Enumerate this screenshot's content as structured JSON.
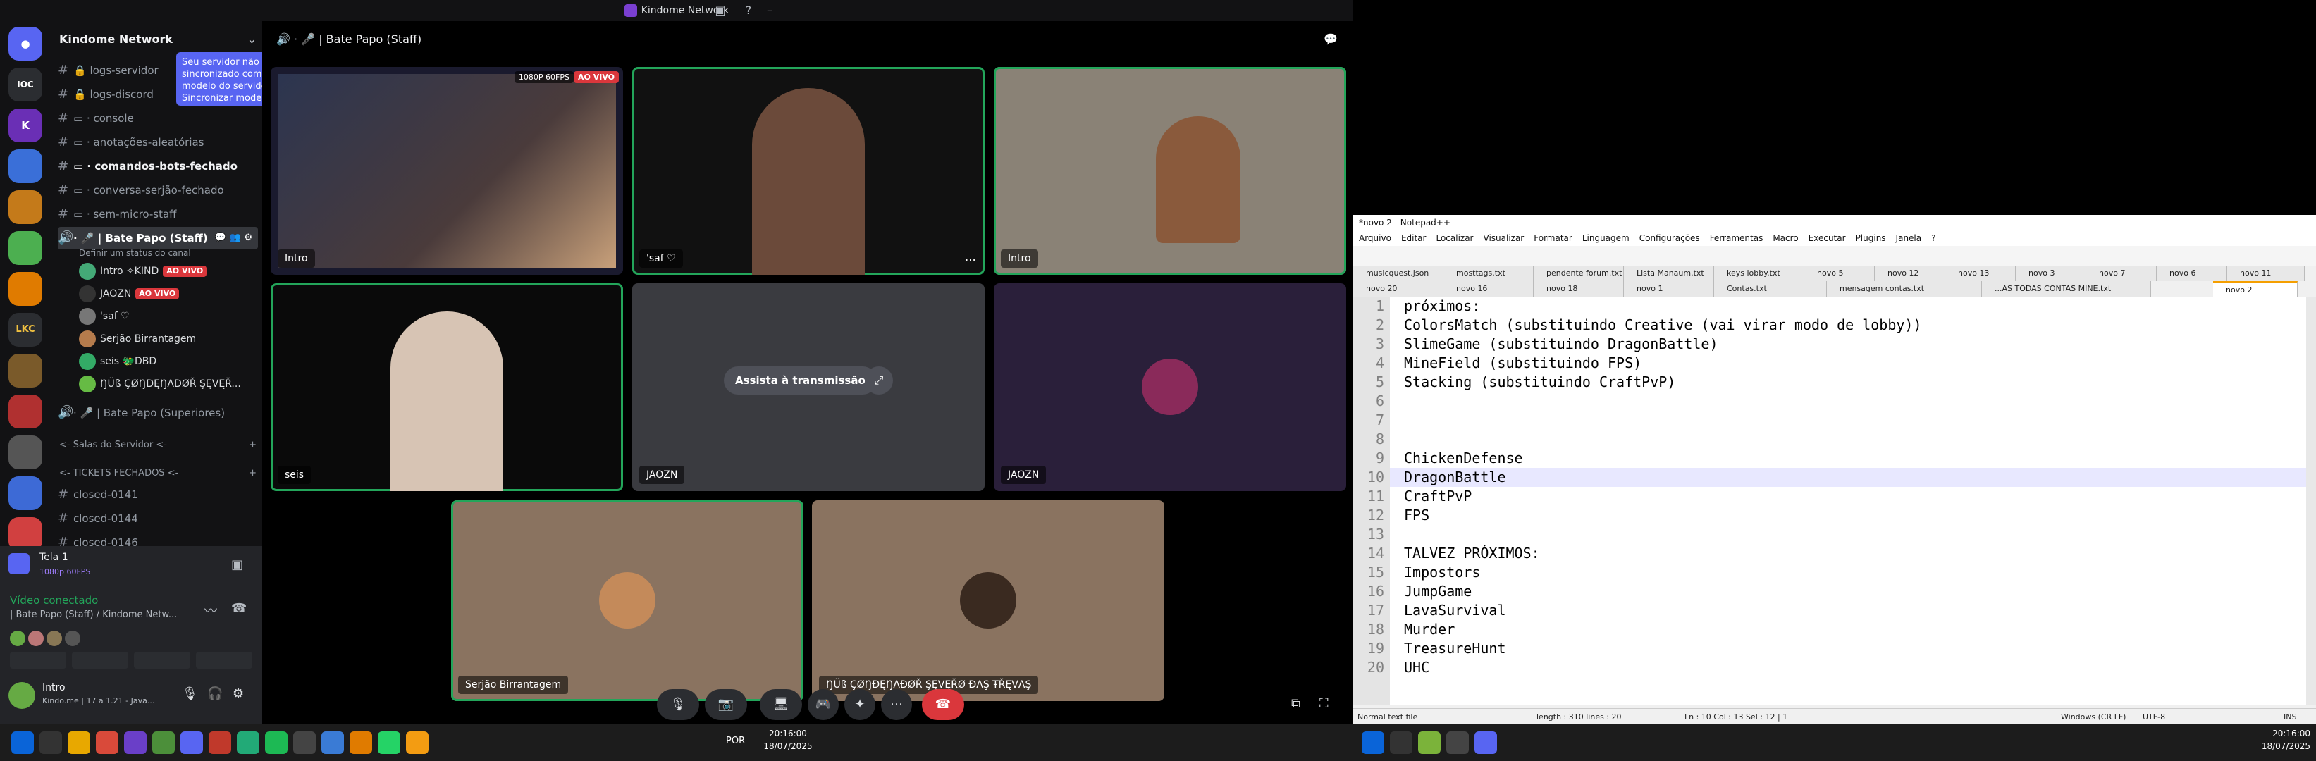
{
  "discord": {
    "window_title": "Kindome Network",
    "server_name": "Kindome Network",
    "tooltip": "Seu servidor não está sincronizado com o modelo do servidor. Sincronizar modelo?",
    "channels": [
      {
        "name": "logs-servidor"
      },
      {
        "name": "logs-discord"
      },
      {
        "name": "console"
      },
      {
        "name": "anotações-aleatórias"
      },
      {
        "name": "comandos-bots-fechado"
      },
      {
        "name": "conversa-serjão-fechado"
      },
      {
        "name": "sem-micro-staff"
      }
    ],
    "active_voice_channel": "| Bate Papo (Staff)",
    "channel_status_hint": "Definir um status do canal",
    "voice_users": [
      {
        "name": "Intro ✧KIND",
        "live": "AO VIVO"
      },
      {
        "name": "JAOZN",
        "live": "AO VIVO"
      },
      {
        "name": "'saf ♡",
        "live": ""
      },
      {
        "name": "Serjão Birrantagem",
        "live": ""
      },
      {
        "name": "seis 🐲DBD",
        "live": ""
      },
      {
        "name": "ŊŨß ÇØŊĐĘŊΛĐØŘ ŞĘVĘŘ...",
        "live": ""
      }
    ],
    "voice_channel_2": "| Bate Papo (Superiores)",
    "categories": [
      "<- Salas do Servidor <-",
      "<- TICKETS FECHADOS <-"
    ],
    "closed_channels": [
      "closed-0141",
      "closed-0144",
      "closed-0146"
    ],
    "stream_panel": {
      "title": "Tela 1",
      "quality": "1080p 60FPS"
    },
    "voice_status": {
      "title": "Vídeo conectado",
      "channel": "| Bate Papo (Staff) / Kindome Netw..."
    },
    "user": {
      "name": "Intro",
      "status": "Kindo.me | 17 a 1.21 - Java..."
    },
    "call_header": "| Bate Papo (Staff)",
    "stream_badge": "1080P 60FPS",
    "live_badge": "AO VIVO",
    "tiles": [
      {
        "label": "Intro"
      },
      {
        "label": "'saf ♡"
      },
      {
        "label": "Intro"
      },
      {
        "label": "seis"
      },
      {
        "label": "JAOZN"
      },
      {
        "label": "JAOZN"
      },
      {
        "label": "Serjão Birrantagem"
      },
      {
        "label": "ŊŨß ÇØŊĐĘŊΛĐØŘ ŞĘVĘŘØ ĐΛŞ ŦŘĘVΛŞ"
      }
    ],
    "watch_stream": "Assista à transmissão",
    "colors": {
      "accent": "#5865f2",
      "live": "#da373c",
      "speaking": "#23a55a",
      "hangup": "#da373c"
    }
  },
  "taskbar": {
    "lang": "POR",
    "time": "20:16:00",
    "date": "18/07/2025"
  },
  "notepad": {
    "title": "*novo 2 - Notepad++",
    "menu": [
      "Arquivo",
      "Editar",
      "Localizar",
      "Visualizar",
      "Formatar",
      "Linguagem",
      "Configurações",
      "Ferramentas",
      "Macro",
      "Executar",
      "Plugins",
      "Janela",
      "?"
    ],
    "tabs_row1": [
      "musicquest.json",
      "mosttags.txt",
      "pendente forum.txt",
      "Lista Manaum.txt",
      "keys lobby.txt",
      "novo 5",
      "novo 12",
      "novo 13",
      "novo 3",
      "novo 7",
      "novo 6",
      "novo 11"
    ],
    "tabs_row2": [
      "novo 20",
      "novo 16",
      "novo 18",
      "novo 1",
      "Contas.txt",
      "mensagem contas.txt",
      "...AS TODAS CONTAS MINE.txt",
      "novo 2"
    ],
    "lines": [
      "próximos:",
      "ColorsMatch (substituindo Creative (vai virar modo de lobby))",
      "SlimeGame (substituindo DragonBattle)",
      "MineField (substituindo FPS)",
      "Stacking (substituindo CraftPvP)",
      "",
      "",
      "",
      "ChickenDefense",
      "DragonBattle",
      "CraftPvP",
      "FPS",
      "",
      "TALVEZ PRÓXIMOS:",
      "Impostors",
      "JumpGame",
      "LavaSurvival",
      "Murder",
      "TreasureHunt",
      "UHC"
    ],
    "status": {
      "type": "Normal text file",
      "length": "length : 310   lines : 20",
      "pos": "Ln : 10   Col : 13   Sel : 12 | 1",
      "eol": "Windows (CR LF)",
      "enc": "UTF-8",
      "mode": "INS"
    },
    "taskbar": {
      "time": "20:16:00",
      "date": "18/07/2025"
    }
  }
}
